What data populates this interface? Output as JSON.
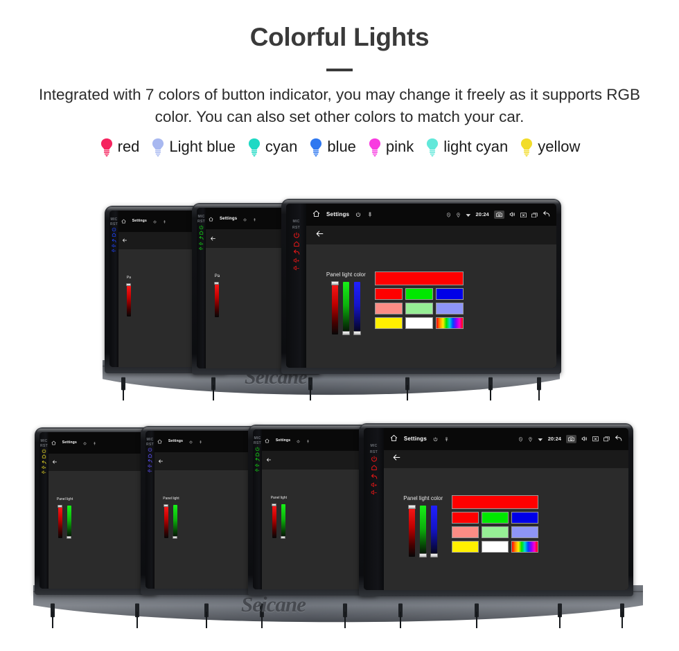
{
  "header": {
    "title": "Colorful Lights",
    "subtitle": "Integrated with 7 colors of button indicator, you may change it freely as it supports RGB color. You can also set other colors to match your car."
  },
  "legend": {
    "items": [
      {
        "label": "red",
        "color": "#f5245f",
        "icon": "bulb-icon"
      },
      {
        "label": "Light blue",
        "color": "#a8b8f0",
        "icon": "bulb-icon"
      },
      {
        "label": "cyan",
        "color": "#1fd9c4",
        "icon": "bulb-icon"
      },
      {
        "label": "blue",
        "color": "#2f78f0",
        "icon": "bulb-icon"
      },
      {
        "label": "pink",
        "color": "#f83ce0",
        "icon": "bulb-icon"
      },
      {
        "label": "light cyan",
        "color": "#62e8da",
        "icon": "bulb-icon"
      },
      {
        "label": "yellow",
        "color": "#f2dc2a",
        "icon": "bulb-icon"
      }
    ]
  },
  "brand": {
    "name": "Seicane"
  },
  "screen": {
    "status": {
      "home_icon": "home-icon",
      "title": "Settings",
      "power_icon": "power-icon",
      "gps_icon": "location-pin-icon",
      "alarm_icon": "alarm-icon",
      "loc_icon": "location-icon",
      "wifi_icon": "wifi-icon",
      "time": "20:24",
      "camera_icon": "camera-icon",
      "volume_icon": "speaker-icon",
      "close_icon": "close-box-icon",
      "recents_icon": "recents-icon",
      "back_icon": "back-arrow-icon"
    },
    "action": {
      "back_icon": "back-arrow-icon"
    },
    "panel": {
      "label": "Panel light color",
      "label_clipped": "Panel light",
      "label_clipped_short": "Pa",
      "sliders": [
        {
          "name": "red",
          "color": "#ff1a1a",
          "knob": "top"
        },
        {
          "name": "green",
          "color": "#18f018",
          "knob": "bottom"
        },
        {
          "name": "blue",
          "color": "#2020ff",
          "knob": "bottom"
        }
      ],
      "preview_color": "#ff0000",
      "swatches": [
        {
          "name": "red",
          "color": "#ff0000"
        },
        {
          "name": "green",
          "color": "#00e800"
        },
        {
          "name": "blue",
          "color": "#0000e8"
        },
        {
          "name": "light-red",
          "color": "#fb8c85"
        },
        {
          "name": "light-green",
          "color": "#96ee95"
        },
        {
          "name": "light-blue",
          "color": "#8e95f6"
        },
        {
          "name": "yellow",
          "color": "#fff000"
        },
        {
          "name": "white",
          "color": "#ffffff"
        },
        {
          "name": "rainbow",
          "color": "rainbow"
        }
      ]
    }
  },
  "units": {
    "top_row": [
      {
        "name": "unit-blue",
        "led_color": "#1f45ff",
        "sliders": 1
      },
      {
        "name": "unit-green",
        "led_color": "#13d213",
        "sliders": 1
      },
      {
        "name": "unit-red",
        "led_color": "#e01717",
        "sliders": 3
      }
    ],
    "bottom_row": [
      {
        "name": "unit-yellow",
        "led_color": "#ded024",
        "sliders": 2
      },
      {
        "name": "unit-purple",
        "led_color": "#5a4df0",
        "sliders": 2
      },
      {
        "name": "unit-green",
        "led_color": "#13d213",
        "sliders": 2
      },
      {
        "name": "unit-red",
        "led_color": "#e01717",
        "sliders": 3
      }
    ],
    "key_labels": {
      "mic": "MIC",
      "rst": "RST"
    },
    "keys": [
      {
        "name": "power-key",
        "icon": "power-icon"
      },
      {
        "name": "home-key",
        "icon": "home-icon"
      },
      {
        "name": "back-key",
        "icon": "back-arrow-icon"
      },
      {
        "name": "volume-up-key",
        "icon": "volume-up-icon"
      },
      {
        "name": "volume-down-key",
        "icon": "volume-down-icon"
      }
    ]
  }
}
